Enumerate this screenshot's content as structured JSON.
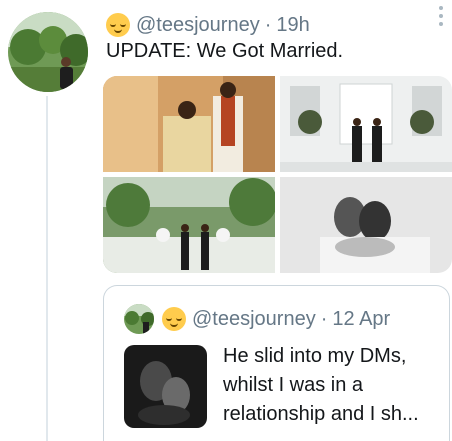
{
  "tweet": {
    "handle": "@teesjourney",
    "separator": "·",
    "time": "19h",
    "text": "UPDATE: We Got Married.",
    "author_emoji": "relieved-face",
    "media_count": 4
  },
  "quoted_tweet": {
    "handle": "@teesjourney",
    "separator": "·",
    "date": "12 Apr",
    "text_lines": [
      "He slid into my DMs,",
      "whilst I was in a",
      "relationship and I sh..."
    ],
    "author_emoji": "relieved-face"
  },
  "colors": {
    "text": "#14171a",
    "secondary": "#657786",
    "border": "#ccd6dd",
    "thread_line": "#e1e8ed"
  }
}
